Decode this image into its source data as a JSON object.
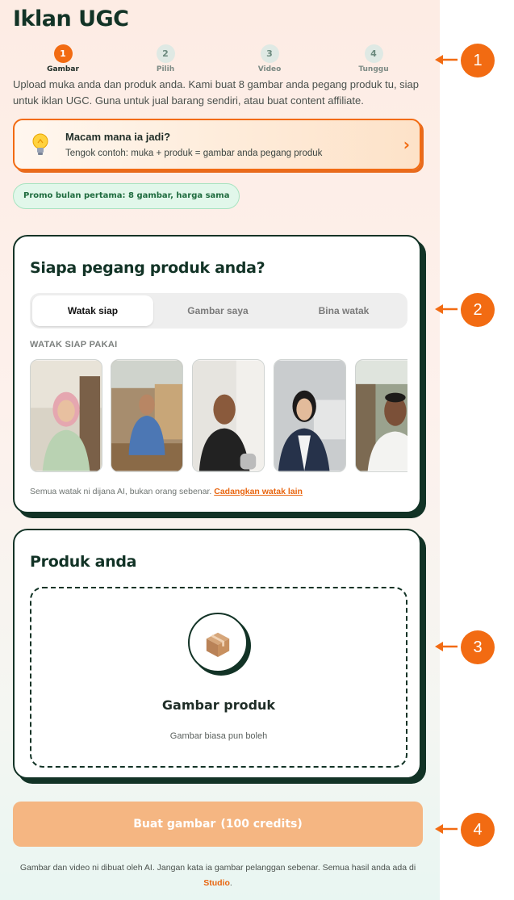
{
  "title": "Iklan UGC",
  "stepper": {
    "steps": [
      {
        "num": "1",
        "label": "Gambar"
      },
      {
        "num": "2",
        "label": "Pilih"
      },
      {
        "num": "3",
        "label": "Video"
      },
      {
        "num": "4",
        "label": "Tunggu"
      }
    ],
    "active_index": 0
  },
  "intro": "Upload muka anda dan produk anda. Kami buat 8 gambar anda pegang produk tu, siap untuk iklan UGC. Guna untuk jual barang sendiri, atau buat content affiliate.",
  "how_card": {
    "title": "Macam mana ia jadi?",
    "subtitle": "Tengok contoh: muka + produk = gambar anda pegang produk",
    "chevron": "›"
  },
  "promo": "Promo bulan pertama: 8 gambar, harga sama",
  "character_card": {
    "title": "Siapa pegang produk anda?",
    "tabs": [
      "Watak siap",
      "Gambar saya",
      "Bina watak"
    ],
    "active_tab": 0,
    "section_label": "WATAK SIAP PAKAI",
    "characters": [
      {
        "name": "woman-hijab-photo"
      },
      {
        "name": "man-workshop-photo"
      },
      {
        "name": "man-selfie-photo"
      },
      {
        "name": "woman-office-photo"
      },
      {
        "name": "man-kitchen-photo"
      }
    ],
    "disclaimer": "Semua watak ni dijana AI, bukan orang sebenar.",
    "suggest_link": "Cadangkan watak lain"
  },
  "product_card": {
    "title": "Produk anda",
    "drop_title": "Gambar produk",
    "drop_sub": "Gambar biasa pun boleh",
    "icon": "package-icon"
  },
  "cta": {
    "label": "Buat gambar",
    "credits": "(100 credits)"
  },
  "footer": {
    "text": "Gambar dan video ni dibuat oleh AI. Jangan kata ia gambar pelanggan sebenar. Semua hasil anda ada di",
    "link": "Studio",
    "end": "."
  },
  "callouts": [
    "1",
    "2",
    "3",
    "4"
  ],
  "colors": {
    "accent": "#f26b12",
    "dark": "#123326",
    "cta_disabled": "#f5b682",
    "promo_bg": "#e1f7ea"
  }
}
